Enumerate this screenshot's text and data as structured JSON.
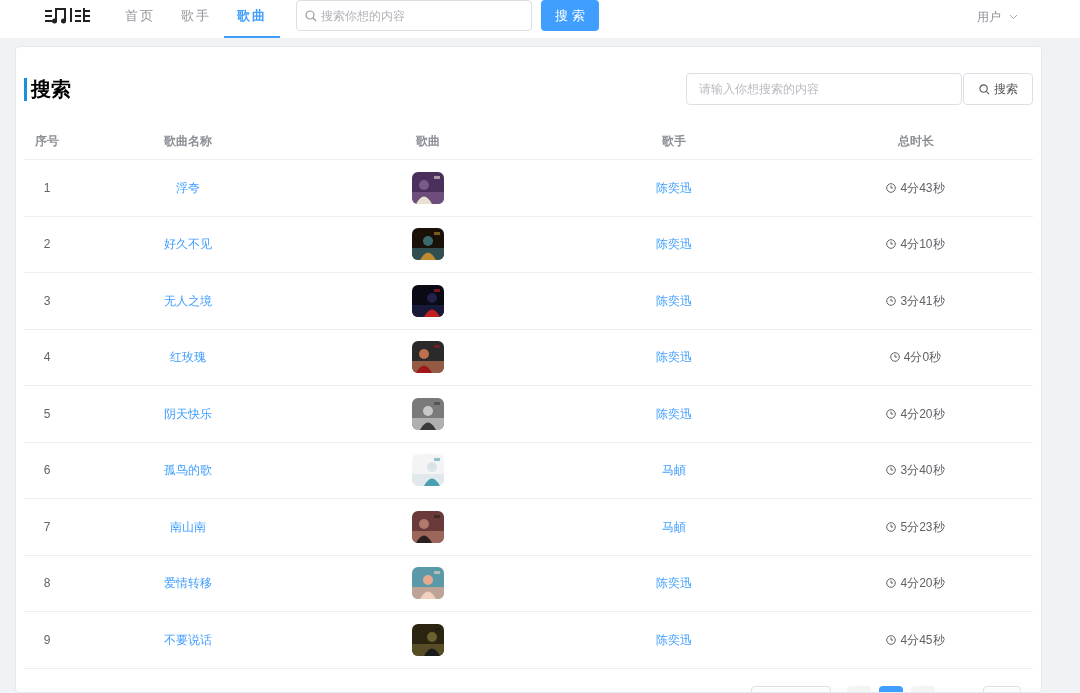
{
  "nav": {
    "items": [
      {
        "label": "首页",
        "selected": false
      },
      {
        "label": "歌手",
        "selected": false
      },
      {
        "label": "歌曲",
        "selected": true
      }
    ],
    "search": {
      "placeholder": "搜索你想的内容"
    },
    "search_button": "搜 索",
    "user_menu": "用户"
  },
  "panel": {
    "title": "搜索",
    "search": {
      "placeholder": "请输入你想搜索的内容"
    },
    "search_button": "搜索"
  },
  "table": {
    "columns": [
      "序号",
      "歌曲名称",
      "歌曲",
      "歌手",
      "总时长"
    ],
    "rows": [
      {
        "index": "1",
        "title": "浮夸",
        "artist": "陈奕迅",
        "duration": "4分43秒"
      },
      {
        "index": "2",
        "title": "好久不见",
        "artist": "陈奕迅",
        "duration": "4分10秒"
      },
      {
        "index": "3",
        "title": "无人之境",
        "artist": "陈奕迅",
        "duration": "3分41秒"
      },
      {
        "index": "4",
        "title": "红玫瑰",
        "artist": "陈奕迅",
        "duration": "4分0秒"
      },
      {
        "index": "5",
        "title": "阴天快乐",
        "artist": "陈奕迅",
        "duration": "4分20秒"
      },
      {
        "index": "6",
        "title": "孤鸟的歌",
        "artist": "马頔",
        "duration": "3分40秒"
      },
      {
        "index": "7",
        "title": "南山南",
        "artist": "马頔",
        "duration": "5分23秒"
      },
      {
        "index": "8",
        "title": "爱情转移",
        "artist": "陈奕迅",
        "duration": "4分20秒"
      },
      {
        "index": "9",
        "title": "不要说话",
        "artist": "陈奕迅",
        "duration": "4分45秒"
      }
    ]
  },
  "pagination": {
    "pages": [
      {
        "selected": true
      }
    ]
  }
}
